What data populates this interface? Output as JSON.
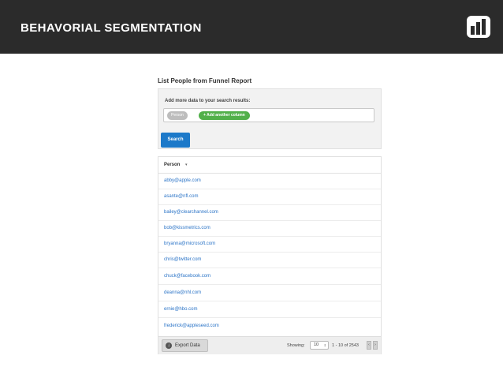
{
  "header": {
    "title": "BEHAVORIAL SEGMENTATION",
    "logo_icon": "bar-chart-logo-icon"
  },
  "panel": {
    "title": "List People from Funnel Report"
  },
  "search": {
    "label": "Add more data to your search results:",
    "chip_person": "Person",
    "chip_add": "+ Add another column",
    "button": "Search"
  },
  "table": {
    "column_header": "Person",
    "rows": [
      "abby@apple.com",
      "asante@nfl.com",
      "bailey@clearchannel.com",
      "bob@kissmetrics.com",
      "bryanna@microsoft.com",
      "chris@twitter.com",
      "chuck@facebook.com",
      "deanna@nhl.com",
      "ernie@hbo.com",
      "frederick@appleseed.com"
    ]
  },
  "footer": {
    "export_label": "Export Data",
    "showing_label": "Showing:",
    "per_page": "10",
    "range": "1 - 10 of 2543",
    "prev": "‹",
    "next": "›"
  },
  "colors": {
    "header_bg": "#2b2b2b",
    "link": "#2b74c7",
    "search_button": "#1c79c9",
    "add_chip": "#52b04a"
  }
}
